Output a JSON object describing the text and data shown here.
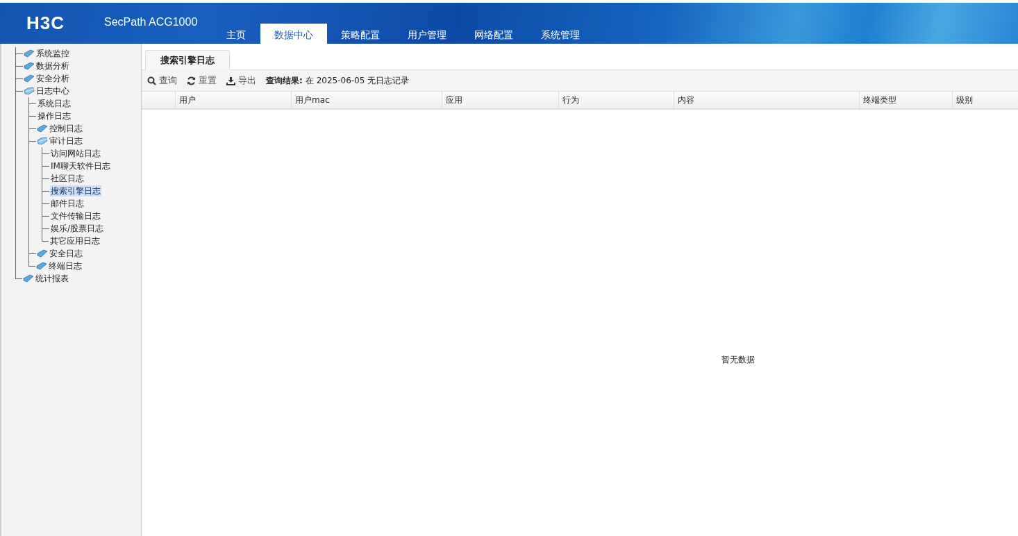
{
  "header": {
    "logo": "H3C",
    "product": "SecPath ACG1000"
  },
  "nav_tabs": [
    {
      "label": "主页",
      "selected": false
    },
    {
      "label": "数据中心",
      "selected": true
    },
    {
      "label": "策略配置",
      "selected": false
    },
    {
      "label": "用户管理",
      "selected": false
    },
    {
      "label": "网络配置",
      "selected": false
    },
    {
      "label": "系统管理",
      "selected": false
    }
  ],
  "sidebar": {
    "tree": [
      {
        "label": "系统监控",
        "kind": "folder",
        "expanded": false,
        "selected": false
      },
      {
        "label": "数据分析",
        "kind": "folder",
        "expanded": false,
        "selected": false
      },
      {
        "label": "安全分析",
        "kind": "folder",
        "expanded": false,
        "selected": false
      },
      {
        "label": "日志中心",
        "kind": "folder",
        "expanded": true,
        "selected": false,
        "children": [
          {
            "label": "系统日志",
            "kind": "leaf",
            "selected": false
          },
          {
            "label": "操作日志",
            "kind": "leaf",
            "selected": false
          },
          {
            "label": "控制日志",
            "kind": "folder",
            "expanded": false,
            "selected": false
          },
          {
            "label": "审计日志",
            "kind": "folder",
            "expanded": true,
            "selected": false,
            "children": [
              {
                "label": "访问网站日志",
                "kind": "leaf",
                "selected": false
              },
              {
                "label": "IM聊天软件日志",
                "kind": "leaf",
                "selected": false
              },
              {
                "label": "社区日志",
                "kind": "leaf",
                "selected": false
              },
              {
                "label": "搜索引擎日志",
                "kind": "leaf",
                "selected": true
              },
              {
                "label": "邮件日志",
                "kind": "leaf",
                "selected": false
              },
              {
                "label": "文件传输日志",
                "kind": "leaf",
                "selected": false
              },
              {
                "label": "娱乐/股票日志",
                "kind": "leaf",
                "selected": false
              },
              {
                "label": "其它应用日志",
                "kind": "leaf",
                "selected": false
              }
            ]
          },
          {
            "label": "安全日志",
            "kind": "folder",
            "expanded": false,
            "selected": false
          },
          {
            "label": "终端日志",
            "kind": "folder",
            "expanded": false,
            "selected": false
          }
        ]
      },
      {
        "label": "统计报表",
        "kind": "folder",
        "expanded": false,
        "selected": false
      }
    ]
  },
  "content_tabs": [
    {
      "label": "搜索引擎日志",
      "selected": true
    }
  ],
  "toolbar": {
    "buttons": [
      {
        "label": "查询",
        "kind": "search"
      },
      {
        "label": "重置",
        "kind": "reset"
      },
      {
        "label": "导出",
        "kind": "export"
      }
    ],
    "result_label": "查询结果:",
    "result_text": "在 2025-06-05 无日志记录"
  },
  "table": {
    "columns": [
      "用户",
      "用户mac",
      "应用",
      "行为",
      "内容",
      "终端类型",
      "级别"
    ],
    "empty_text": "暂无数据"
  }
}
